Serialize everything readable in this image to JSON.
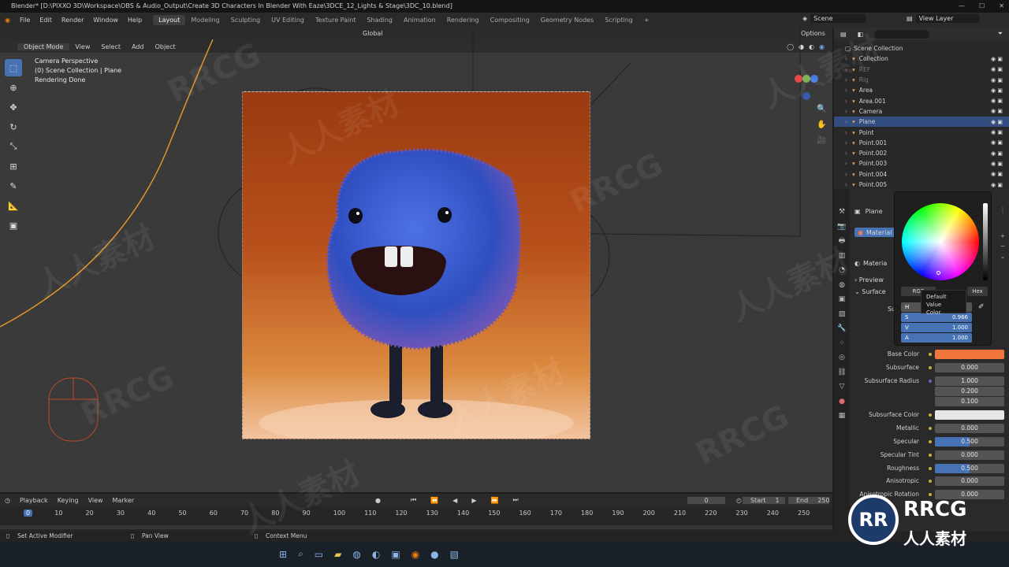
{
  "title": "Blender* [D:\\PIXXO 3D\\Workspace\\OBS & Audio_Output\\Create 3D Characters In Blender With Eaze\\3DCE_12_Lights & Stage\\3DC_10.blend]",
  "menus": [
    "File",
    "Edit",
    "Render",
    "Window",
    "Help"
  ],
  "workspaces": [
    "Layout",
    "Modeling",
    "Sculpting",
    "UV Editing",
    "Texture Paint",
    "Shading",
    "Animation",
    "Rendering",
    "Compositing",
    "Geometry Nodes",
    "Scripting"
  ],
  "active_workspace": "Layout",
  "scene": "Scene",
  "view_layer": "View Layer",
  "viewport": {
    "mode": "Object Mode",
    "menus": [
      "View",
      "Select",
      "Add",
      "Object"
    ],
    "transform": "Global",
    "options": "Options",
    "info": [
      "Camera Perspective",
      "(0) Scene Collection | Plane",
      "Rendering Done"
    ]
  },
  "outliner": {
    "root": "Scene Collection",
    "items": [
      {
        "name": "Collection",
        "dim": false
      },
      {
        "name": "REF",
        "dim": true
      },
      {
        "name": "Rig",
        "dim": true
      },
      {
        "name": "Area",
        "dim": false
      },
      {
        "name": "Area.001",
        "dim": false
      },
      {
        "name": "Camera",
        "dim": false
      },
      {
        "name": "Plane",
        "dim": false,
        "selected": true
      },
      {
        "name": "Point",
        "dim": false
      },
      {
        "name": "Point.001",
        "dim": false
      },
      {
        "name": "Point.002",
        "dim": false
      },
      {
        "name": "Point.003",
        "dim": false
      },
      {
        "name": "Point.004",
        "dim": false
      },
      {
        "name": "Point.005",
        "dim": false
      }
    ]
  },
  "properties": {
    "object": "Plane",
    "material_slot": "Material",
    "material_name": "Materia",
    "preview": "Preview",
    "surface": "Surface",
    "surface_label": "Su",
    "rows": [
      {
        "label": "Base Color",
        "value": "",
        "fill": 0,
        "color": "#f0763e"
      },
      {
        "label": "Subsurface",
        "value": "0.000",
        "fill": 0
      },
      {
        "label": "Subsurface Radius",
        "value": "1.000",
        "fill": 0,
        "dot": "p"
      },
      {
        "label": "",
        "value": "0.200",
        "fill": 0,
        "nodot": true
      },
      {
        "label": "",
        "value": "0.100",
        "fill": 0,
        "nodot": true
      },
      {
        "label": "Subsurface Color",
        "value": "",
        "fill": 0,
        "color": "#e6e6e6"
      },
      {
        "label": "Metallic",
        "value": "0.000",
        "fill": 0
      },
      {
        "label": "Specular",
        "value": "0.500",
        "fill": 0.5
      },
      {
        "label": "Specular Tint",
        "value": "0.000",
        "fill": 0
      },
      {
        "label": "Roughness",
        "value": "0.500",
        "fill": 0.5
      },
      {
        "label": "Anisotropic",
        "value": "0.000",
        "fill": 0
      },
      {
        "label": "Anisotropic Rotation",
        "value": "0.000",
        "fill": 0
      }
    ]
  },
  "picker": {
    "tabs": [
      "RGB",
      "Hex"
    ],
    "h_label": "H",
    "s_label": "S",
    "s_value": "0.966",
    "v_label": "V",
    "v_value": "1.000",
    "a_label": "A",
    "a_value": "1.000",
    "tooltip": [
      "Default Value",
      "Color."
    ]
  },
  "timeline": {
    "menus": [
      "Playback",
      "Keying",
      "View",
      "Marker"
    ],
    "current": "0",
    "start_label": "Start",
    "start": "1",
    "end_label": "End",
    "end": "250",
    "ticks": [
      "0",
      "10",
      "20",
      "30",
      "40",
      "50",
      "60",
      "70",
      "80",
      "90",
      "100",
      "110",
      "120",
      "130",
      "140",
      "150",
      "160",
      "170",
      "180",
      "190",
      "200",
      "210",
      "220",
      "230",
      "240",
      "250"
    ]
  },
  "status": [
    "Set Active Modifier",
    "Pan View",
    "Context Menu"
  ],
  "watermark": [
    "RRCG",
    "人人素材"
  ],
  "colors": {
    "accent": "#4772b3",
    "selected": "#334d80"
  }
}
